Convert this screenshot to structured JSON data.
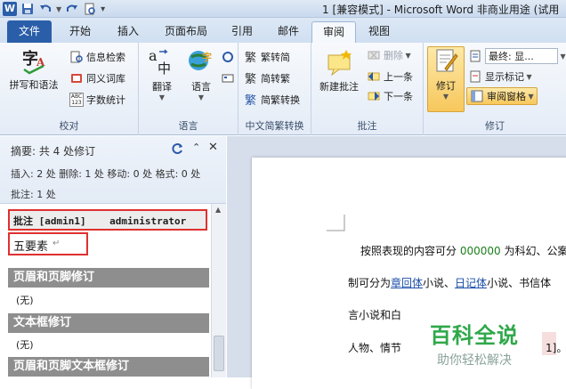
{
  "titlebar": {
    "title": "1 [兼容模式] - Microsoft Word 非商业用途 (试用",
    "word_icon": "W",
    "icons": [
      "word-icon",
      "save-icon",
      "undo-icon",
      "redo-icon",
      "print-preview-icon",
      "customize-icon"
    ]
  },
  "tabs": [
    {
      "label": "文件"
    },
    {
      "label": "开始"
    },
    {
      "label": "插入"
    },
    {
      "label": "页面布局"
    },
    {
      "label": "引用"
    },
    {
      "label": "邮件"
    },
    {
      "label": "审阅"
    },
    {
      "label": "视图"
    }
  ],
  "ribbon": {
    "proofing": {
      "label": "校对",
      "spell": "拼写和语法",
      "research": "信息检索",
      "thesaurus": "同义词库",
      "wordcount": "字数统计",
      "wordcount_icon_text": "ABC\n123"
    },
    "language": {
      "label": "语言",
      "translate": "翻译",
      "language": "语言"
    },
    "chinese": {
      "label": "中文简繁转换",
      "t2s": "繁转简",
      "s2t": "简转繁",
      "convert": "简繁转换"
    },
    "comments": {
      "label": "批注",
      "new": "新建批注",
      "delete": "删除",
      "prev": "上一条",
      "next": "下一条"
    },
    "tracking": {
      "label": "修订",
      "track": "修订",
      "final": "最终: 显...",
      "show_markup": "显示标记",
      "reviewing_pane": "审阅窗格"
    }
  },
  "panel": {
    "summary": "摘要: 共 4 处修订",
    "stats1": "插入: 2 处  删除: 1 处  移动: 0 处  格式: 0 处",
    "stats2": "批注: 1 处",
    "comment_header": "批注 [admin1]    administrator",
    "comment_text": "五要素",
    "comment_mark": "↵",
    "sections": [
      {
        "title": "页眉和页脚修订",
        "value": "(无)"
      },
      {
        "title": "文本框修订",
        "value": "(无)"
      },
      {
        "title": "页眉和页脚文本框修订",
        "value": ""
      }
    ]
  },
  "document": {
    "line1_a": "按照表现的内容可分",
    "line1_b": "000000",
    "line1_c": "为科幻、公案",
    "line2_a": "制可分为",
    "line2_b": "章回体",
    "line2_c": "小说、",
    "line2_d": "日记体",
    "line2_e": "小说、书信体",
    "line3": "言小说和白",
    "line4_a": "人物、情节",
    "line4_b": "1]",
    "line4_c": "。"
  },
  "watermark": {
    "title": "百科全说",
    "subtitle": "助你轻松解决"
  },
  "colors": {
    "accent": "#2a5ea8",
    "insert": "#1a7f1a",
    "comment_border": "#e03030",
    "watermark": "#2fa84a"
  }
}
